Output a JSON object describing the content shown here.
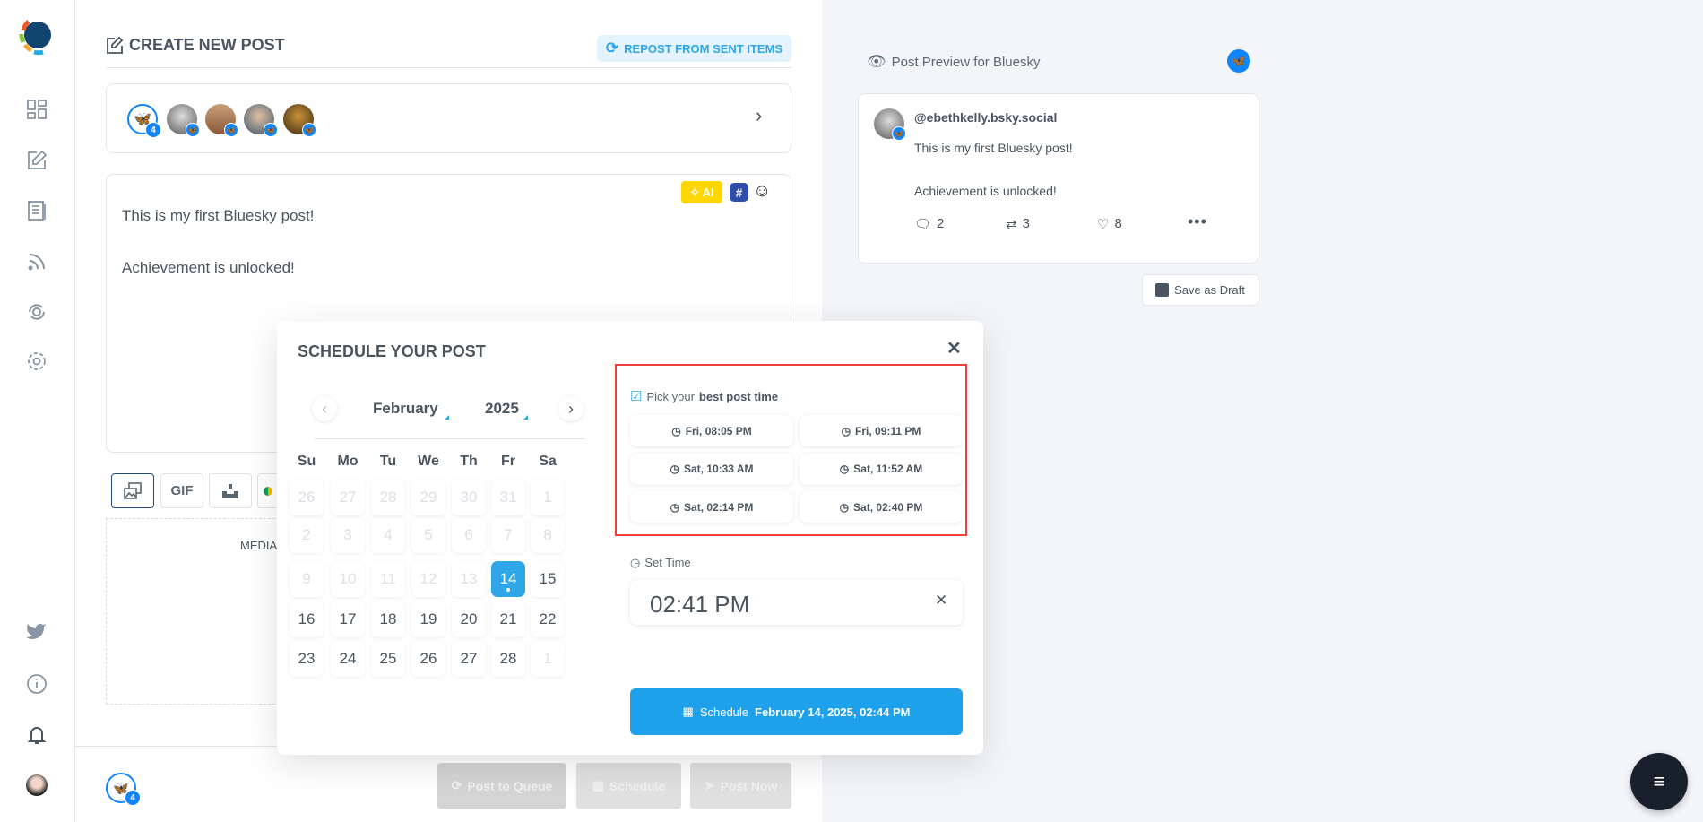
{
  "sidebar": {
    "items": [
      "dashboard",
      "create-post",
      "posts",
      "rss-feed",
      "recycle",
      "settings"
    ],
    "bottom": [
      "twitter",
      "info",
      "notifications",
      "profile"
    ]
  },
  "composer": {
    "title": "CREATE NEW POST",
    "repost_label": "REPOST FROM SENT ITEMS",
    "account_count": "4",
    "ai_label": "AI",
    "text_line1": "This is my first Bluesky post!",
    "text_line2": "Achievement is unlocked!",
    "media_tools": {
      "gif": "GIF"
    },
    "media_label": "MEDIA",
    "footer": {
      "account_count": "4",
      "post_to_queue": "Post to Queue",
      "schedule": "Schedule",
      "post_now": "Post Now"
    }
  },
  "modal": {
    "title": "SCHEDULE YOUR POST",
    "month": "February",
    "year": "2025",
    "weekdays": [
      "Su",
      "Mo",
      "Tu",
      "We",
      "Th",
      "Fr",
      "Sa"
    ],
    "weeks": [
      [
        [
          "26",
          "dim"
        ],
        [
          "27",
          "dim"
        ],
        [
          "28",
          "dim"
        ],
        [
          "29",
          "dim"
        ],
        [
          "30",
          "dim"
        ],
        [
          "31",
          "dim"
        ],
        [
          "1",
          "dim"
        ]
      ],
      [
        [
          "2",
          "dim"
        ],
        [
          "3",
          "dim"
        ],
        [
          "4",
          "dim"
        ],
        [
          "5",
          "dim"
        ],
        [
          "6",
          "dim"
        ],
        [
          "7",
          "dim"
        ],
        [
          "8",
          "dim"
        ]
      ],
      [
        [
          "9",
          "dim"
        ],
        [
          "10",
          "dim"
        ],
        [
          "11",
          "dim"
        ],
        [
          "12",
          "dim"
        ],
        [
          "13",
          "dim"
        ],
        [
          "14",
          "sel"
        ],
        [
          "15",
          ""
        ]
      ],
      [
        [
          "16",
          ""
        ],
        [
          "17",
          ""
        ],
        [
          "18",
          ""
        ],
        [
          "19",
          ""
        ],
        [
          "20",
          ""
        ],
        [
          "21",
          ""
        ],
        [
          "22",
          ""
        ]
      ],
      [
        [
          "23",
          ""
        ],
        [
          "24",
          ""
        ],
        [
          "25",
          ""
        ],
        [
          "26",
          ""
        ],
        [
          "27",
          ""
        ],
        [
          "28",
          ""
        ],
        [
          "1",
          "dim"
        ]
      ]
    ],
    "best_time_prefix": "Pick your",
    "best_time_bold": "best post time",
    "best_times": [
      "Fri, 08:05 PM",
      "Fri, 09:11 PM",
      "Sat, 10:33 AM",
      "Sat, 11:52 AM",
      "Sat, 02:14 PM",
      "Sat, 02:40 PM"
    ],
    "set_time_label": "Set Time",
    "time_value": "02:41 PM",
    "schedule_label": "Schedule",
    "schedule_date": "February 14, 2025, 02:44 PM"
  },
  "preview": {
    "header": "Post Preview for Bluesky",
    "handle": "@ebethkelly.bsky.social",
    "line1": "This is my first Bluesky post!",
    "line2": "Achievement is unlocked!",
    "replies": "2",
    "reposts": "3",
    "likes": "8",
    "save_draft": "Save as Draft"
  },
  "colors": {
    "accent": "#2ea6e8",
    "bluesky": "#1185fe",
    "highlight_box": "#ef3e3e",
    "ai": "#ffd600",
    "fab": "#18202c"
  }
}
